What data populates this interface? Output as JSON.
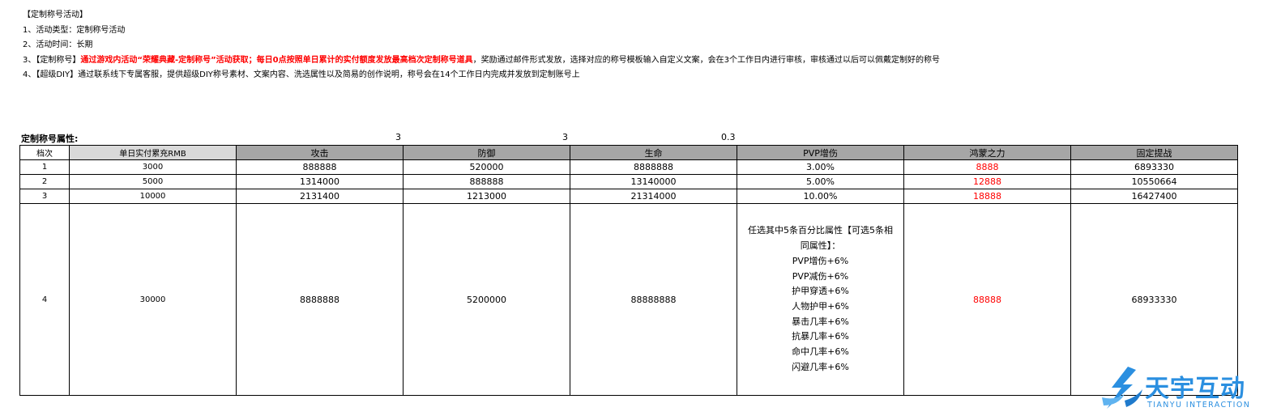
{
  "intro": {
    "title": "【定制称号活动】",
    "line1": "1、活动类型：定制称号活动",
    "line2": "2、活动时间：长期",
    "line3_prefix": "3、【定制称号】",
    "line3_highlight": "通过游戏内活动“荣耀典藏-定制称号”活动获取；每日0点按照单日累计的实付额度发放最高档次定制称号道具",
    "line3_suffix": "，奖励通过邮件形式发放，选择对应的称号模板输入自定义文案，会在3个工作日内进行审核，审核通过以后可以佩戴定制好的称号",
    "line4": "4、【超级DIY】通过联系线下专属客服，提供超级DIY称号素材、文案内容、洗选属性以及简易的创作说明，称号会在14个工作日内完成并发放到定制账号上"
  },
  "props": {
    "label": "定制称号属性:",
    "multipliers": [
      "3",
      "3",
      "0.3"
    ]
  },
  "table": {
    "headers": [
      "档次",
      "单日实付累充RMB",
      "攻击",
      "防御",
      "生命",
      "PVP增伤",
      "鸿蒙之力",
      "固定提战"
    ],
    "rows": [
      [
        "1",
        "3000",
        "888888",
        "520000",
        "8888888",
        "3.00%",
        "8888",
        "6893330"
      ],
      [
        "2",
        "5000",
        "1314000",
        "888888",
        "13140000",
        "5.00%",
        "12888",
        "10550664"
      ],
      [
        "3",
        "10000",
        "2131400",
        "1213000",
        "21314000",
        "10.00%",
        "18888",
        "16427400"
      ]
    ],
    "row4": {
      "tier": "4",
      "rmb": "30000",
      "attack": "8888888",
      "defense": "5200000",
      "hp": "88888888",
      "pvp_lines": [
        "任选其中5条百分比属性【可选5条相",
        "同属性】：",
        "PVP增伤+6%",
        "PVP减伤+6%",
        "护甲穿透+6%",
        "人物护甲+6%",
        "暴击几率+6%",
        "抗暴几率+6%",
        "命中几率+6%",
        "闪避几率+6%"
      ],
      "hongmeng": "88888",
      "power": "68933330"
    }
  },
  "logo": {
    "cn": "天宇互动",
    "en": "TIANYU INTERACTION",
    "icon": "tianyu-logo-icon",
    "color": "#2b8fe0"
  },
  "colors": {
    "highlight": "#ff0000",
    "header_gray": "#a6a6a6",
    "header_light": "#d9d9d9"
  }
}
